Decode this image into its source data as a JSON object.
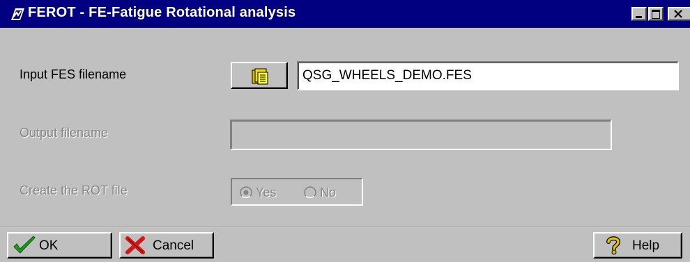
{
  "window": {
    "title": "FEROT - FE-Fatigue Rotational analysis",
    "title_bar_color": "#000080",
    "icon": "ferot-app-icon",
    "controls": [
      "minimize-icon",
      "maximize-icon",
      "close-icon"
    ]
  },
  "form": {
    "input_fes": {
      "label": "Input FES filename",
      "value": "QSG_WHEELS_DEMO.FES",
      "browse_icon": "folder-browse-icon",
      "enabled": true
    },
    "output": {
      "label": "Output filename",
      "value": "",
      "enabled": false
    },
    "create_rot": {
      "label": "Create the ROT file",
      "enabled": false,
      "options": [
        {
          "label": "Yes",
          "selected": true
        },
        {
          "label": "No",
          "selected": false
        }
      ]
    }
  },
  "buttons": {
    "ok_label": "OK",
    "ok_icon": "checkmark-icon",
    "cancel_label": "Cancel",
    "cancel_icon": "red-x-icon",
    "help_label": "Help",
    "help_icon": "question-mark-icon"
  },
  "colors": {
    "dialog_bg": "#c0c0c0",
    "disabled_text": "#858585",
    "ok_check": "#1f9a1f",
    "cancel_x": "#d01818",
    "help_question": "#e0c000"
  }
}
